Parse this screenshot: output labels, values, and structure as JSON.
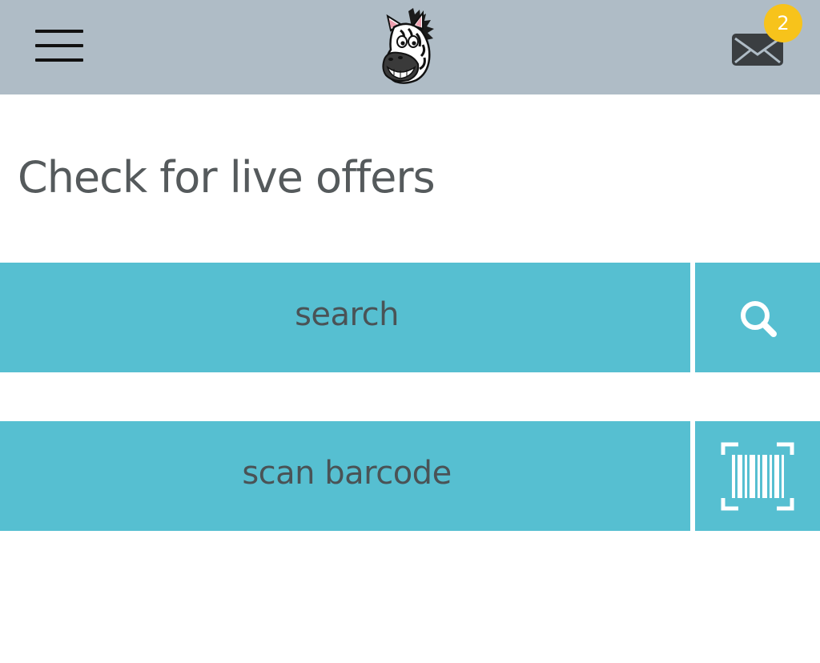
{
  "header": {
    "menu_icon": "hamburger-menu-icon",
    "logo_icon": "zebra-logo-icon",
    "mail_icon": "envelope-icon",
    "notification_count": "2",
    "bar_color": "#afbcc6",
    "badge_color": "#f7c31b"
  },
  "main": {
    "heading": "Check for live offers",
    "search": {
      "label": "search",
      "icon": "search-icon"
    },
    "scan": {
      "label": "scan barcode",
      "icon": "barcode-scan-icon"
    },
    "accent_color": "#56bfd1"
  }
}
